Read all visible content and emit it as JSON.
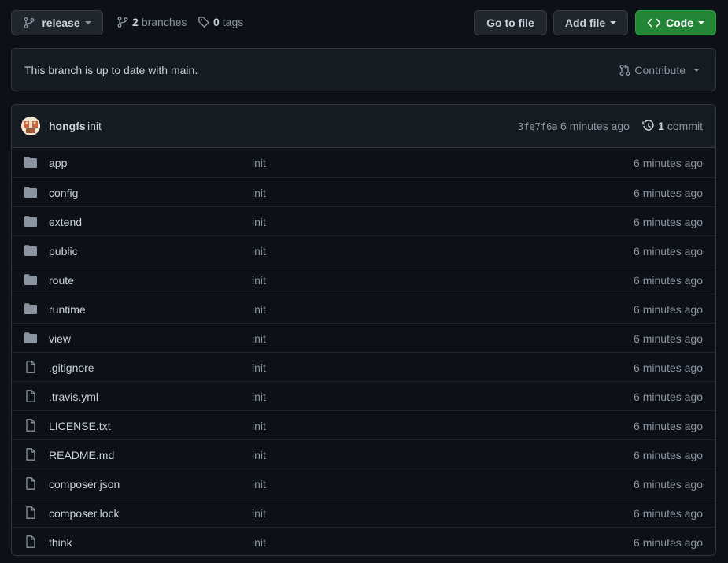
{
  "toolbar": {
    "branch_label": "release",
    "branches_count": "2",
    "branches_label": "branches",
    "tags_count": "0",
    "tags_label": "tags",
    "go_to_file_label": "Go to file",
    "add_file_label": "Add file",
    "code_label": "Code"
  },
  "banner": {
    "message": "This branch is up to date with main.",
    "contribute_label": "Contribute"
  },
  "commit": {
    "author": "hongfs",
    "message": "init",
    "sha": "3fe7f6a",
    "age": "6 minutes ago",
    "count": "1",
    "count_label": "commit"
  },
  "files": [
    {
      "name": "app",
      "type": "folder",
      "message": "init",
      "age": "6 minutes ago"
    },
    {
      "name": "config",
      "type": "folder",
      "message": "init",
      "age": "6 minutes ago"
    },
    {
      "name": "extend",
      "type": "folder",
      "message": "init",
      "age": "6 minutes ago"
    },
    {
      "name": "public",
      "type": "folder",
      "message": "init",
      "age": "6 minutes ago"
    },
    {
      "name": "route",
      "type": "folder",
      "message": "init",
      "age": "6 minutes ago"
    },
    {
      "name": "runtime",
      "type": "folder",
      "message": "init",
      "age": "6 minutes ago"
    },
    {
      "name": "view",
      "type": "folder",
      "message": "init",
      "age": "6 minutes ago"
    },
    {
      "name": ".gitignore",
      "type": "file",
      "message": "init",
      "age": "6 minutes ago"
    },
    {
      "name": ".travis.yml",
      "type": "file",
      "message": "init",
      "age": "6 minutes ago"
    },
    {
      "name": "LICENSE.txt",
      "type": "file",
      "message": "init",
      "age": "6 minutes ago"
    },
    {
      "name": "README.md",
      "type": "file",
      "message": "init",
      "age": "6 minutes ago"
    },
    {
      "name": "composer.json",
      "type": "file",
      "message": "init",
      "age": "6 minutes ago"
    },
    {
      "name": "composer.lock",
      "type": "file",
      "message": "init",
      "age": "6 minutes ago"
    },
    {
      "name": "think",
      "type": "file",
      "message": "init",
      "age": "6 minutes ago"
    }
  ],
  "colors": {
    "background": "#0d1117",
    "surface": "#161b22",
    "border": "#30363d",
    "code_button": "#238636",
    "muted_text": "#8b949e",
    "text": "#c9d1d9"
  }
}
